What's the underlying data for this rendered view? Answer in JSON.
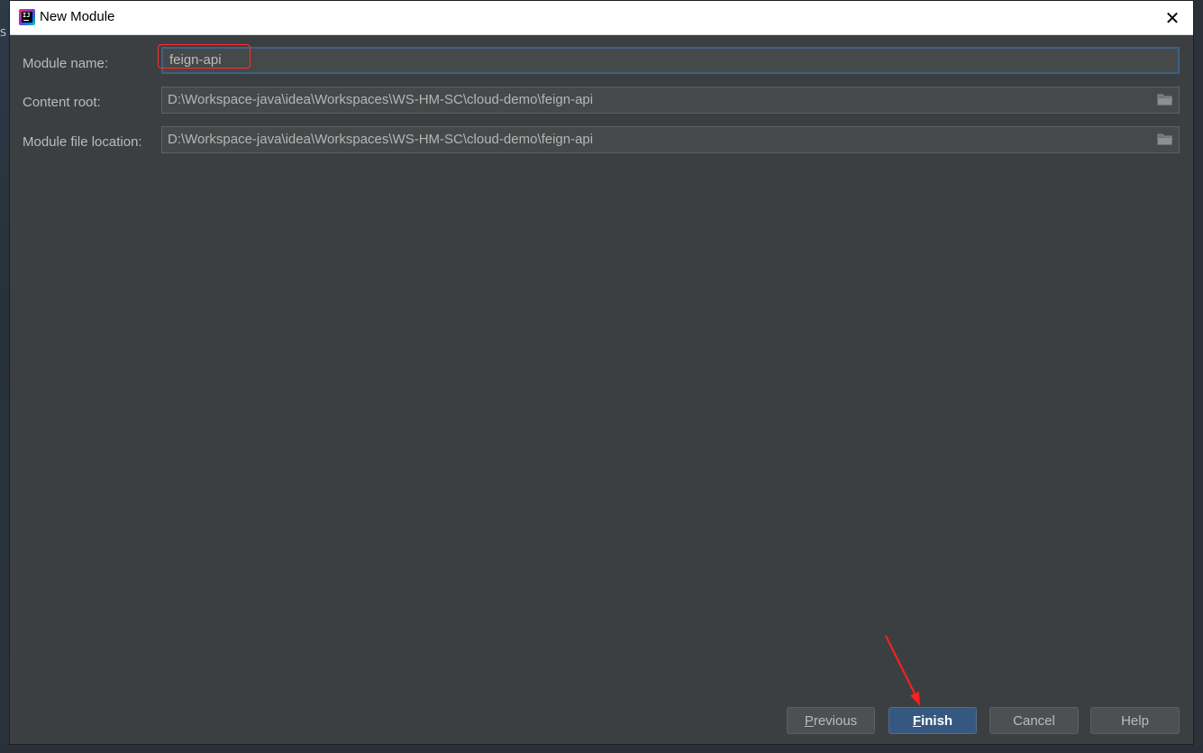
{
  "window": {
    "title": "New Module",
    "close_glyph": "✕"
  },
  "background": {
    "peek_text": "S"
  },
  "form": {
    "module_name": {
      "label": "Module name:",
      "value": "feign-api"
    },
    "content_root": {
      "label": "Content root:",
      "value": "D:\\Workspace-java\\idea\\Workspaces\\WS-HM-SC\\cloud-demo\\feign-api"
    },
    "module_file_location": {
      "label": "Module file location:",
      "value": "D:\\Workspace-java\\idea\\Workspaces\\WS-HM-SC\\cloud-demo\\feign-api"
    }
  },
  "buttons": {
    "previous": {
      "mnemonic": "P",
      "rest": "revious"
    },
    "finish": {
      "mnemonic": "F",
      "rest": "inish"
    },
    "cancel": {
      "label": "Cancel"
    },
    "help": {
      "label": "Help"
    }
  },
  "colors": {
    "dialog_bg": "#3c3f41",
    "primary_button": "#365880",
    "annotation": "#ff2d2d",
    "focus_border": "#3d6185"
  },
  "icons": [
    "intellij-idea-icon",
    "close-icon",
    "folder-icon",
    "annotation-arrow-icon"
  ]
}
